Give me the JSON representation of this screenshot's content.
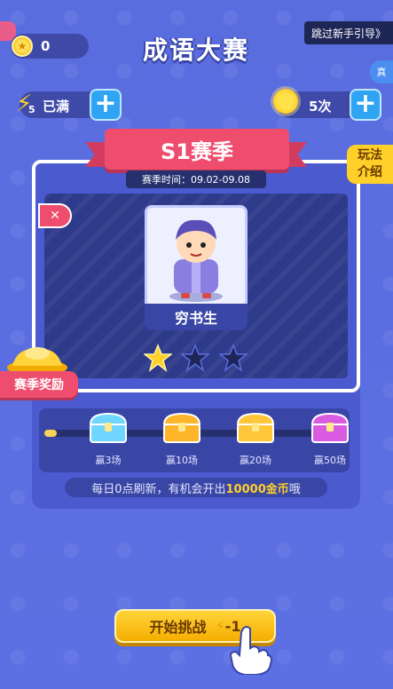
{
  "topbar": {
    "coin_value": "0",
    "title": "成语大赛",
    "skip_label": "跳过新手引导》",
    "side_tab": "真"
  },
  "resources": {
    "energy_count": "5",
    "energy_label": "已满",
    "plus": "+",
    "sun_label": "5次"
  },
  "season": {
    "title": "S1赛季",
    "time_label": "赛季时间：09.02-09.08",
    "play_guide": "玩法介绍",
    "character_name": "穷书生",
    "stars_filled": 1,
    "stars_total": 3,
    "reward_label": "赛季奖励"
  },
  "progress": {
    "fraction": 0.04,
    "chests": [
      {
        "label": "赢3场",
        "color": "#6fd6ff"
      },
      {
        "label": "赢10场",
        "color": "#ffb52a"
      },
      {
        "label": "赢20场",
        "color": "#ffc63a"
      },
      {
        "label": "赢50场",
        "color": "#d95ce0"
      }
    ]
  },
  "info": {
    "prefix": "每日0点刷新，有机会开出",
    "highlight": "10000金币",
    "suffix": "哦"
  },
  "start_button": {
    "label": "开始挑战",
    "cost": "-1"
  }
}
